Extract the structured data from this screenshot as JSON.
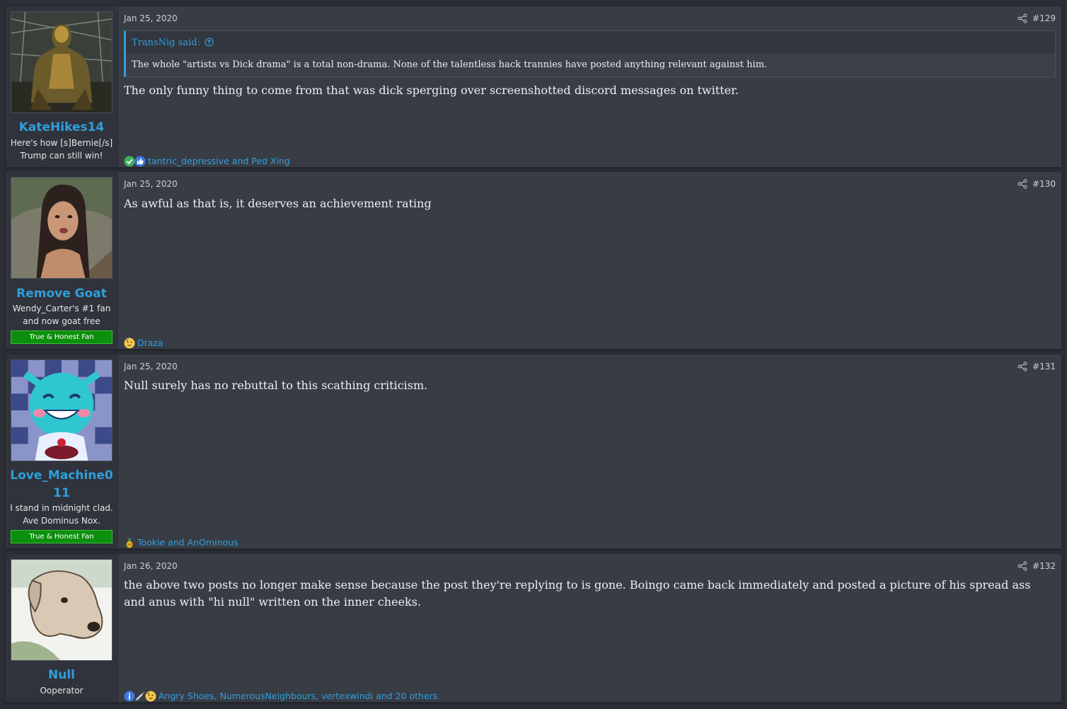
{
  "posts": [
    {
      "user": {
        "name": "KateHikes14",
        "title": "Here's how [s]Bernie[/s] Trump can still win!",
        "banner": ""
      },
      "date": "Jan 25, 2020",
      "number": "#129",
      "quote": {
        "author": "TransNig said:",
        "text": "The whole \"artists vs Dick drama\" is a total non-drama. None of the talentless hack trannies have posted anything relevant against him."
      },
      "message": "The only funny thing to come from that was dick sperging over screenshotted discord messages on twitter.",
      "reactions": {
        "icons": [
          "check-icon",
          "thumbs-up-icon"
        ],
        "names": "tantric_depressive and Ped Xing"
      }
    },
    {
      "user": {
        "name": "Remove Goat",
        "title": "Wendy_Carter's #1 fan and now goat free",
        "banner": "True & Honest Fan"
      },
      "date": "Jan 25, 2020",
      "number": "#130",
      "message": "As awful as that is, it deserves an achievement rating",
      "reactions": {
        "icons": [
          "thinking-icon"
        ],
        "names": "Draza"
      }
    },
    {
      "user": {
        "name": "Love_Machine011",
        "title": "I stand in midnight clad. Ave Dominus Nox.",
        "banner": "True & Honest Fan"
      },
      "date": "Jan 25, 2020",
      "number": "#131",
      "message": "Null surely has no rebuttal to this scathing criticism.",
      "reactions": {
        "icons": [
          "pineapple-icon"
        ],
        "names": "Tookie and AnOminous"
      }
    },
    {
      "user": {
        "name": "Null",
        "title": "Ooperator",
        "banner": ""
      },
      "date": "Jan 26, 2020",
      "number": "#132",
      "message": "the above two posts no longer make sense because the post they're replying to is gone. Boingo came back immediately and posted a picture of his spread ass and anus with \"hi null\" written on the inner cheeks.",
      "reactions": {
        "icons": [
          "info-icon",
          "syringe-icon",
          "thinking-icon"
        ],
        "names": "Angry Shoes, NumerousNeighbours, vertexwindi and 20 others"
      }
    }
  ],
  "colors": {
    "link": "#2e9fdc",
    "banner": "#0c8f0c",
    "post_bg": "#383c45",
    "user_bg": "#30333b"
  }
}
